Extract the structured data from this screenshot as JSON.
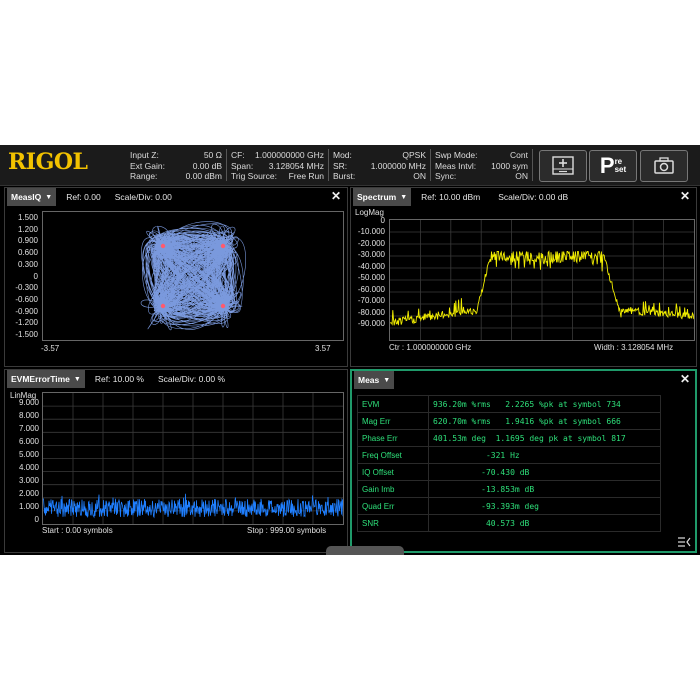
{
  "header": {
    "logo": "RIGOL",
    "col1": [
      {
        "label": "Input Z:",
        "value": "50 Ω"
      },
      {
        "label": "Ext Gain:",
        "value": "0.00 dB"
      },
      {
        "label": "Range:",
        "value": "0.00 dBm"
      }
    ],
    "col2": [
      {
        "label": "CF:",
        "value": "1.000000000 GHz"
      },
      {
        "label": "Span:",
        "value": "3.128054 MHz"
      },
      {
        "label": "Trig Source:",
        "value": "Free Run"
      }
    ],
    "col3": [
      {
        "label": "Mod:",
        "value": "QPSK"
      },
      {
        "label": "SR:",
        "value": "1.000000 MHz"
      },
      {
        "label": "Burst:",
        "value": "ON"
      }
    ],
    "col4": [
      {
        "label": "Swp Mode:",
        "value": "Cont"
      },
      {
        "label": "Meas Intvl:",
        "value": "1000 sym"
      },
      {
        "label": "Sync:",
        "value": "ON"
      }
    ],
    "buttons": {
      "preset_big": "P",
      "preset_small_top": "re",
      "preset_small_bottom": "set"
    }
  },
  "meas_iq": {
    "title": "MeasIQ",
    "ref": "Ref: 0.00",
    "scale": "Scale/Div: 0.00",
    "y_ticks": [
      "1.500",
      "1.200",
      "0.900",
      "0.600",
      "0.300",
      "0",
      "-0.300",
      "-0.600",
      "-0.900",
      "-1.200",
      "-1.500"
    ],
    "x_left": "-3.57",
    "x_right": "3.57",
    "trace_color": "#87aaf5",
    "point_color": "#ff5a6e"
  },
  "spectrum": {
    "title": "Spectrum",
    "ref": "Ref: 10.00 dBm",
    "scale": "Scale/Div: 0.00 dB",
    "unit": "LogMag",
    "y_ticks": [
      "0",
      "-10.000",
      "-20.000",
      "-30.000",
      "-40.000",
      "-50.000",
      "-60.000",
      "-70.000",
      "-80.000",
      "-90.000"
    ],
    "ctr": "Ctr : 1.000000000 GHz",
    "width": "Width : 3.128054 MHz",
    "trace_color": "#f2ee00"
  },
  "evm": {
    "title": "EVMErrorTime",
    "ref": "Ref: 10.00 %",
    "scale": "Scale/Div: 0.00 %",
    "unit": "LinMag",
    "y_ticks": [
      "9.000",
      "8.000",
      "7.000",
      "6.000",
      "5.000",
      "4.000",
      "3.000",
      "2.000",
      "1.000",
      "0"
    ],
    "start": "Start : 0.00 symbols",
    "stop": "Stop : 999.00 symbols",
    "trace_color": "#1f7fff"
  },
  "meas": {
    "title": "Meas",
    "rows": [
      {
        "label": "EVM",
        "value": "936.20m %rms   2.2265 %pk at symbol 734"
      },
      {
        "label": "Mag Err",
        "value": "620.70m %rms   1.9416 %pk at symbol 666"
      },
      {
        "label": "Phase Err",
        "value": "401.53m deg  1.1695 deg pk at symbol 817"
      },
      {
        "label": "Freq Offset",
        "value": "           -321 Hz"
      },
      {
        "label": "IQ Offset",
        "value": "          -70.430 dB"
      },
      {
        "label": "Gain Imb",
        "value": "          -13.853m dB"
      },
      {
        "label": "Quad Err",
        "value": "          -93.393m deg"
      },
      {
        "label": "SNR",
        "value": "           40.573 dB"
      }
    ]
  },
  "close_glyph": "✕"
}
